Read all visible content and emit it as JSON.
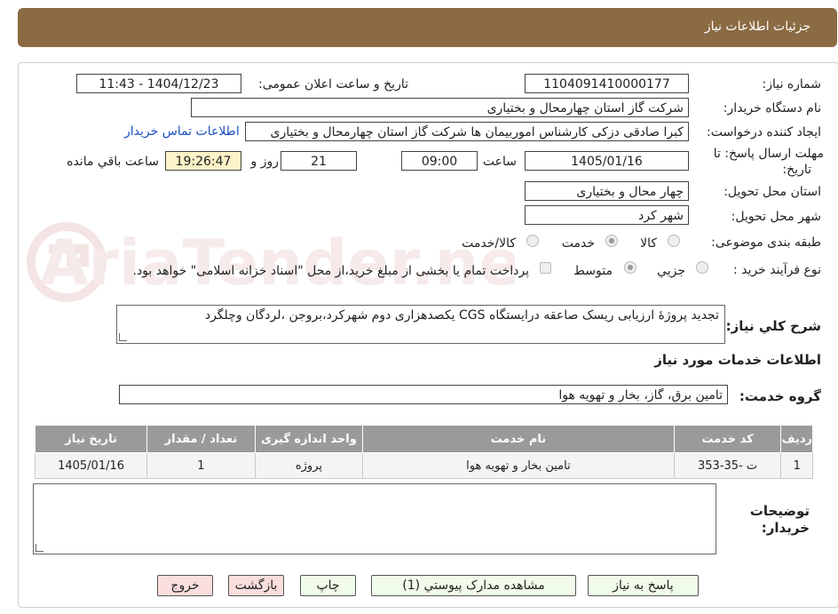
{
  "header": {
    "title": "جزئیات اطلاعات نیاز"
  },
  "watermark": {
    "text": "AriaTender.neT"
  },
  "form": {
    "need_number_label": "شماره نیاز:",
    "need_number": "1104091410000177",
    "announce_label": "تاریخ و ساعت اعلان عمومی:",
    "announce_value": "1404/12/23 - 11:43",
    "buyer_org_label": "نام دستگاه خریدار:",
    "buyer_org": "شرکت گاز استان چهارمحال و بختیاری",
    "requester_label": "ایجاد کننده درخواست:",
    "requester": "کبرا صادقی دزکی کارشناس اموربیمان ها شرکت گاز استان چهارمحال و بختیاری",
    "contact_link": "اطلاعات تماس خریدار",
    "deadline_label_1": "مهلت ارسال پاسخ: تا",
    "deadline_label_2": "تاریخ:",
    "deadline_date": "1405/01/16",
    "time_label": "ساعت",
    "deadline_time": "09:00",
    "days_value": "21",
    "days_label": "روز و",
    "remaining_time": "19:26:47",
    "remaining_label": "ساعت باقي مانده",
    "province_label": "استان محل تحویل:",
    "province": "چهار محال و بختیاری",
    "city_label": "شهر محل تحویل:",
    "city": "شهر کرد",
    "category_label": "طبقه بندی موضوعی:",
    "category_options": [
      "کالا",
      "خدمت",
      "کالا/خدمت"
    ],
    "category_selected": "خدمت",
    "process_label": "نوع فرآیند خرید :",
    "process_options": [
      "جزیي",
      "متوسط"
    ],
    "process_selected": "متوسط",
    "payment_note": "پرداخت تمام یا بخشی از مبلغ خرید،از محل \"اسناد خزانه اسلامی\" خواهد بود.",
    "description_label": "شرح کلي نیاز:",
    "description": "تجدید پروژۀ ارزیابی ریسک صاعقه درایستگاه CGS یکصدهزاری دوم شهرکرد،بروجن ،لردگان وچلگرد",
    "services_title": "اطلاعات خدمات مورد نیاز",
    "service_group_label": "گروه خدمت:",
    "service_group": "تامین برق، گاز، بخار و تهویه هوا",
    "buyer_notes_label_1": "توضیحات",
    "buyer_notes_label_2": "خریدار:",
    "buyer_notes": ""
  },
  "table": {
    "headers": [
      "ردیف",
      "کد خدمت",
      "نام خدمت",
      "واحد اندازه گیری",
      "تعداد / مقدار",
      "تاریخ نیاز"
    ],
    "rows": [
      [
        "1",
        "ت -35-353",
        "تامین بخار و تهویه هوا",
        "پروژه",
        "1",
        "1405/01/16"
      ]
    ]
  },
  "buttons": {
    "reply": "پاسخ به نیاز",
    "attachments": "مشاهده مدارک پیوستي (1)",
    "print": "چاپ",
    "back": "بازگشت",
    "exit": "خروج"
  },
  "colors": {
    "header": "#8b6b43",
    "remaining_bg": "#fdf3c8",
    "link": "#1a4fc4"
  }
}
